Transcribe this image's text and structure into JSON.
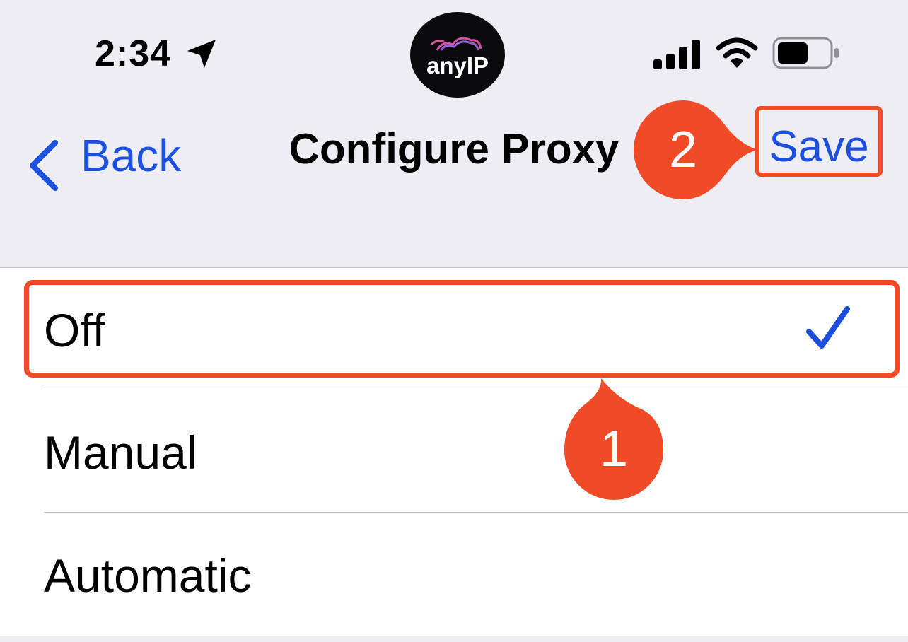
{
  "status_bar": {
    "time": "2:34",
    "location_icon": "location-arrow-icon",
    "logo_text": "anyIP",
    "signal_icon": "cellular-signal-icon",
    "wifi_icon": "wifi-icon",
    "battery_icon": "battery-icon",
    "battery_level": 0.6
  },
  "nav": {
    "back_label": "Back",
    "title": "Configure Proxy",
    "save_label": "Save"
  },
  "options": [
    {
      "label": "Off",
      "selected": true
    },
    {
      "label": "Manual",
      "selected": false
    },
    {
      "label": "Automatic",
      "selected": false
    }
  ],
  "annotations": {
    "step1": "1",
    "step2": "2"
  },
  "colors": {
    "accent_blue": "#1c4fe0",
    "annotation_red": "#f14a27",
    "nav_background": "#eeedf4",
    "checkmark": "#1c4fe0"
  }
}
